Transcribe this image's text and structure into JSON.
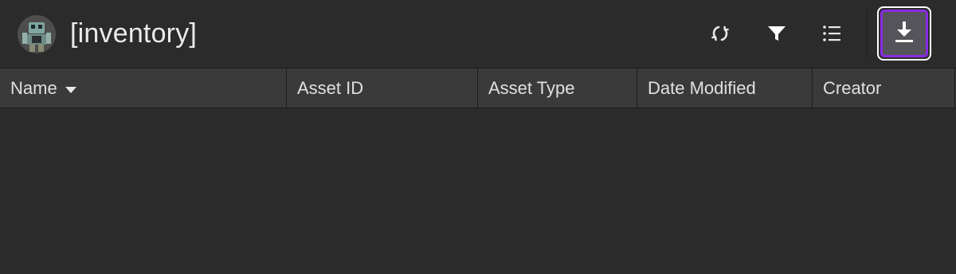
{
  "header": {
    "title": "[inventory]",
    "avatar_icon": "robot-avatar-icon",
    "tools": {
      "refresh_icon": "refresh-icon",
      "filter_icon": "filter-icon",
      "list_icon": "list-view-icon",
      "download_icon": "download-icon"
    }
  },
  "columns": [
    {
      "label": "Name",
      "sorted": "descending"
    },
    {
      "label": "Asset ID"
    },
    {
      "label": "Asset Type"
    },
    {
      "label": "Date Modified"
    },
    {
      "label": "Creator"
    }
  ],
  "rows": [],
  "colors": {
    "background": "#2b2b2b",
    "header_row": "#3a3a3a",
    "selected_outline": "#8a2be2",
    "text": "#e6e6e6"
  }
}
